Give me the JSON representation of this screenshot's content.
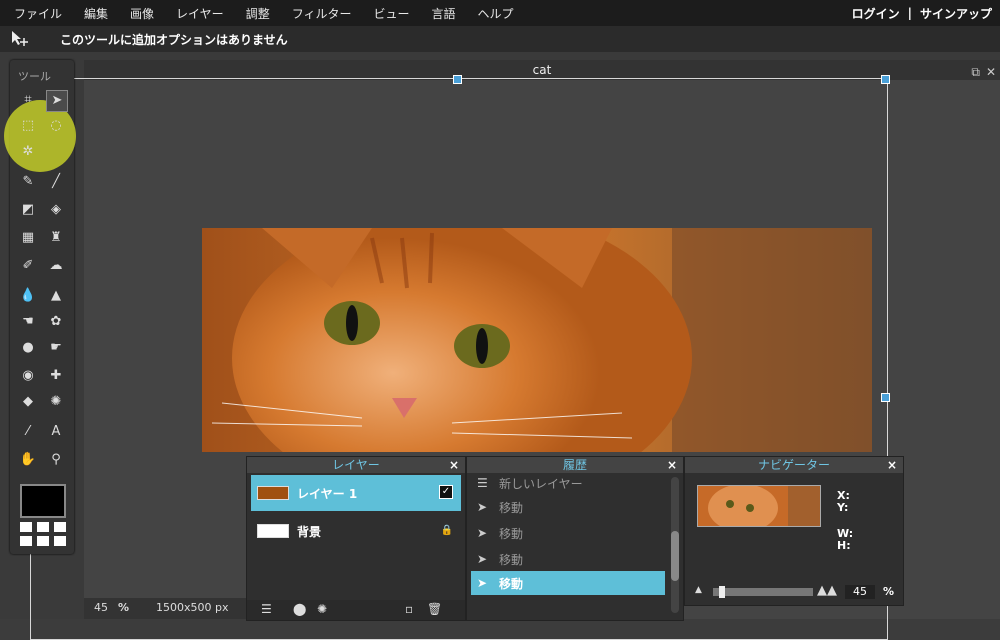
{
  "menubar": {
    "items": [
      "ファイル",
      "編集",
      "画像",
      "レイヤー",
      "調整",
      "フィルター",
      "ビュー",
      "言語",
      "ヘルプ"
    ],
    "login": "ログイン",
    "separator": "|",
    "signup": "サインアップ"
  },
  "options": {
    "tool_icon": "move-tool-icon",
    "message": "このツールに追加オプションはありません"
  },
  "toolbox": {
    "title": "ツール"
  },
  "document": {
    "title": "cat",
    "zoom": "45",
    "zoom_unit": "%",
    "size": "1500x500 px"
  },
  "layers_panel": {
    "title": "レイヤー",
    "close": "×",
    "items": [
      {
        "name": "レイヤー 1",
        "selected": true,
        "visible": true
      },
      {
        "name": "背景",
        "selected": false,
        "locked": true
      }
    ]
  },
  "history_panel": {
    "title": "履歴",
    "close": "×",
    "items": [
      "新しいレイヤー",
      "移動",
      "移動",
      "移動",
      "移動"
    ],
    "selected_index": 4
  },
  "navigator_panel": {
    "title": "ナビゲーター",
    "close": "×",
    "x_label": "X:",
    "y_label": "Y:",
    "w_label": "W:",
    "h_label": "H:",
    "zoom": "45",
    "zoom_unit": "%"
  },
  "colors": {
    "accent": "#5ebfd8",
    "menubar": "#1c1c1c",
    "panel": "#2f2f2f",
    "highlight": "#d7e128"
  }
}
